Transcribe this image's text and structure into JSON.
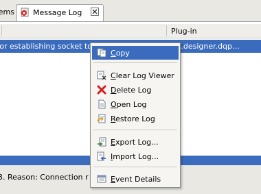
{
  "tabs": {
    "prev_label": "ems",
    "active_label": "Message Log"
  },
  "table": {
    "column_plugin": "Plug-in",
    "selected_row_text": "ror establishing socket to host and port: lqg.teiid.designer.dqp..."
  },
  "detail": {
    "text": "3. Reason: Connection r"
  },
  "menu": {
    "items": [
      {
        "label": "Copy",
        "icon": "copy-icon"
      },
      {
        "label": "Clear Log Viewer",
        "icon": "clear-log-icon"
      },
      {
        "label": "Delete Log",
        "icon": "delete-icon"
      },
      {
        "label": "Open Log",
        "icon": "open-log-icon"
      },
      {
        "label": "Restore Log",
        "icon": "restore-log-icon"
      },
      {
        "label": "Export Log...",
        "icon": "export-log-icon"
      },
      {
        "label": "Import Log...",
        "icon": "import-log-icon"
      },
      {
        "label": "Event Details",
        "icon": "event-details-icon"
      }
    ]
  },
  "colors": {
    "selection": "#3a6bbd",
    "menu_bg": "#f6f5f2",
    "tab_bg": "#e9e8e2"
  }
}
